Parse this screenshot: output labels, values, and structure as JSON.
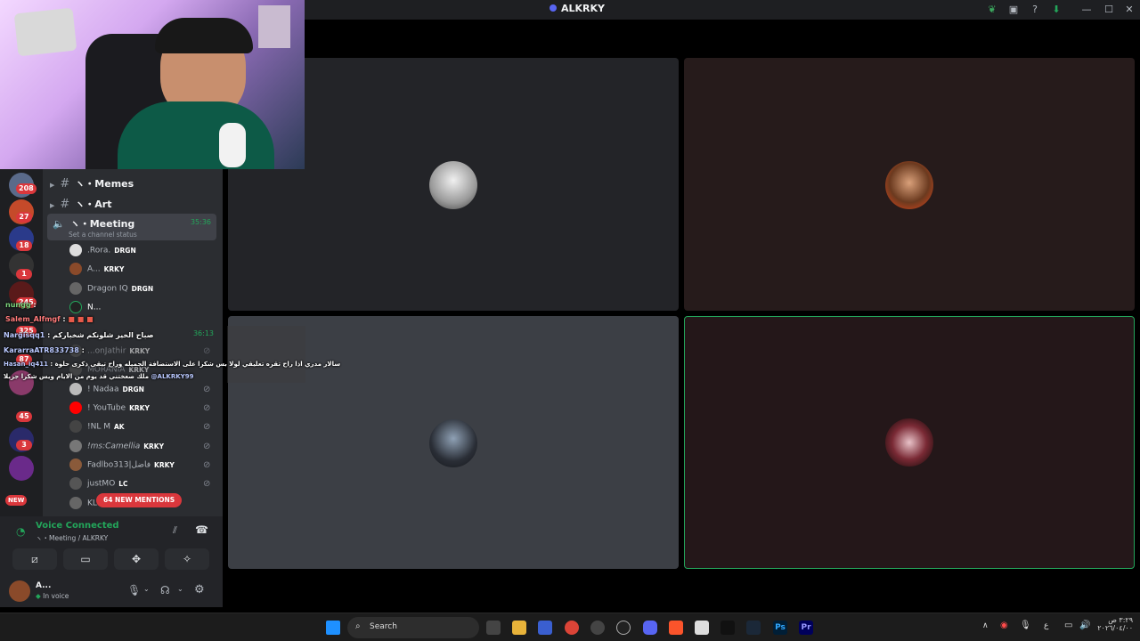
{
  "window": {
    "title": "ALKRKY"
  },
  "channels": [
    {
      "name": "Memes",
      "prefix": "ヽ・"
    },
    {
      "name": "Art",
      "prefix": "ヽ・"
    },
    {
      "name": "Meeting",
      "prefix": "ヽ・",
      "timer": "35:36",
      "status": "Set a channel status"
    }
  ],
  "voice_users_top": [
    {
      "name": ".Rora.",
      "tag": "DRGN"
    },
    {
      "name": "A...",
      "tag": "KRKY"
    },
    {
      "name": "Dragon IQ",
      "tag": "DRGN"
    },
    {
      "name": "N..."
    }
  ],
  "second_timer": "36:13",
  "voice_users_bottom": [
    {
      "name": "! Nadaa",
      "tag": "DRGN"
    },
    {
      "name": "! YouTube",
      "tag": "KRKY"
    },
    {
      "name": "!NL M",
      "tag": "AK"
    },
    {
      "name": "!ms:Camellia",
      "tag": "KRKY"
    },
    {
      "name": "Fadlbo313|فاضل",
      "tag": "KRKY"
    },
    {
      "name": "justMO",
      "tag": "LC"
    },
    {
      "name": "KL..."
    }
  ],
  "hidden_users": [
    "...onJathir",
    "MORANIA"
  ],
  "hidden_tags": [
    "KRKY",
    "KRKY"
  ],
  "mentions_badge": "64 NEW MENTIONS",
  "server_badges": [
    "208",
    "27",
    "18",
    "1",
    "245",
    "325",
    "87",
    "45",
    "3"
  ],
  "new_badge": "NEW",
  "overlay_chat": [
    {
      "name": "nungg",
      "text": ":"
    },
    {
      "name": "Salem_Alfmgf",
      "text": ":"
    },
    {
      "name": "Nargisqq1",
      "text": ": صباح الخير شلونكم شخباركم"
    },
    {
      "name": "KararraATR833738",
      "text": ":"
    },
    {
      "name": "Hasan_iq411",
      "text": ": سالار مدري اذا راح تقره تعليقي لولا بس شكرا على الاستضافة الجميله وراح تبقى ذكرى حلوة"
    },
    {
      "name": "@ALKRKY99",
      "text": "ملك صعختني قد يوم من الايام ويس شكرا جزيلا"
    }
  ],
  "voice_panel": {
    "status": "Voice Connected",
    "location": "ヽ・Meeting / ALKRKY"
  },
  "user_panel": {
    "name": "A...",
    "status": "In voice"
  },
  "taskbar": {
    "search_placeholder": "Search",
    "lang": "ع",
    "time": "٣:٢٩ ص",
    "date": "٢٠٢٦/٠٤/٠٠"
  },
  "colors": {
    "accent_green": "#23a55a",
    "blurple": "#5865f2",
    "red": "#da373c"
  }
}
